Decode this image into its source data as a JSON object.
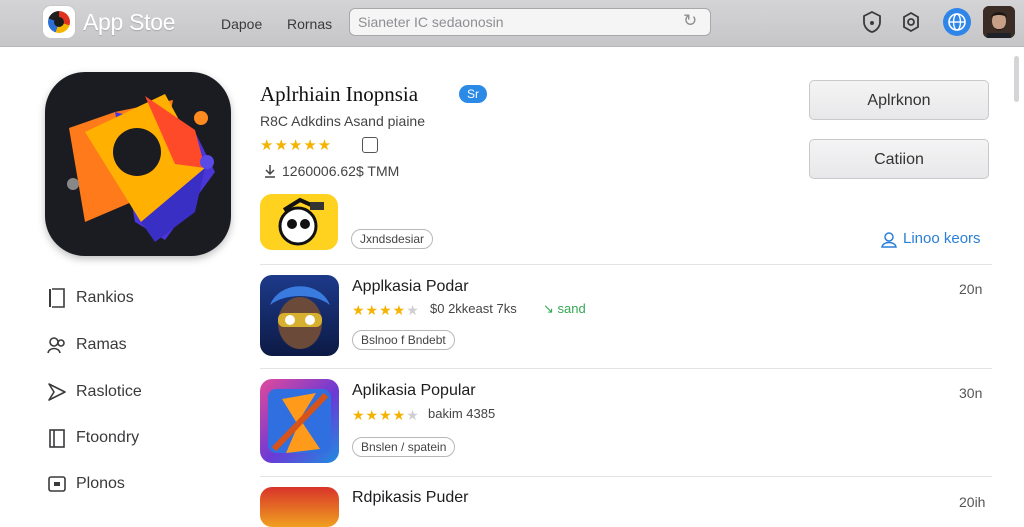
{
  "topbar": {
    "brand": "App Stoe",
    "nav": [
      "Dapoe",
      "Rornas"
    ],
    "search_placeholder": "Sianeter IC sedaonosin"
  },
  "sidebar": {
    "items": [
      {
        "label": "Rankios",
        "icon": "bookmark-icon"
      },
      {
        "label": "Ramas",
        "icon": "people-icon"
      },
      {
        "label": "Raslotice",
        "icon": "send-icon"
      },
      {
        "label": "Ftoondry",
        "icon": "book-icon"
      },
      {
        "label": "Plonos",
        "icon": "grid-icon"
      }
    ]
  },
  "hero": {
    "title": "Aplrhiain Inopnsia",
    "badge": "Sr",
    "subtitle": "R8C Adkdins Asand piaine",
    "rating_stars": 5,
    "downloads": "1260006.62$ TMM",
    "primary_button": "Aplrknon",
    "secondary_button": "Catiion",
    "chip": "Jxndsdesiar",
    "link": "Linoo keors"
  },
  "list": [
    {
      "title": "Applkasia Podar",
      "rating_stars": 4,
      "meta": "$0 2kkeast 7ks",
      "trend": "sand",
      "chip": "Bslnoo f Bndebt",
      "size": "20n"
    },
    {
      "title": "Aplikasia Popular",
      "rating_stars": 4,
      "meta": "bakim 4385",
      "chip": "Bnslen / spatein",
      "size": "30n"
    },
    {
      "title": "Rdpikasis Puder",
      "size": "20ih"
    }
  ],
  "colors": {
    "accent": "#2b8ae6",
    "star": "#f5b301",
    "topbar": "#c8c8ca"
  }
}
